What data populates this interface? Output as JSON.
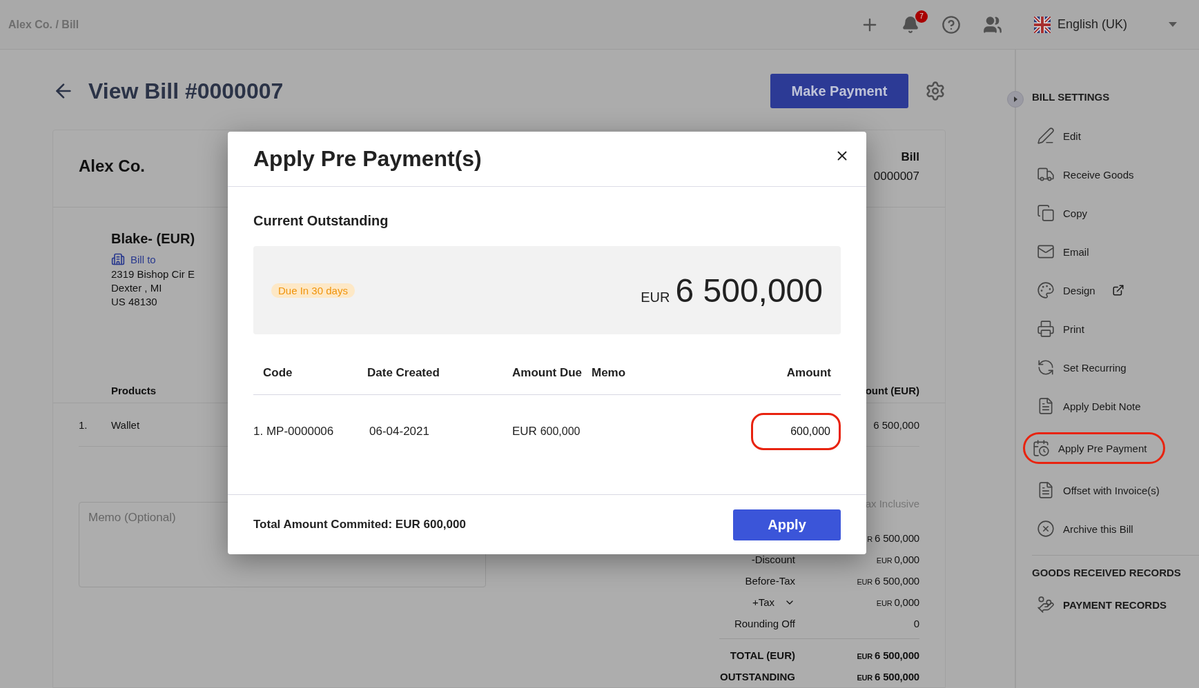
{
  "breadcrumb": "Alex Co. / Bill",
  "topbar": {
    "notification_count": "7",
    "language": "English (UK)"
  },
  "page": {
    "title": "View Bill #0000007",
    "primary_button": "Make Payment"
  },
  "bill": {
    "company": "Alex Co.",
    "doc_label": "Bill",
    "doc_number": "0000007",
    "vendor": "Blake- (EUR)",
    "bill_to_label": "Bill to",
    "address": [
      "2319 Bishop Cir E",
      "Dexter , MI",
      "US 48130"
    ],
    "products_header": "Products",
    "amount_header": "ount (EUR)",
    "lines": [
      {
        "index": "1.",
        "product": "Wallet",
        "amount": "6 500,000"
      }
    ],
    "memo_placeholder": "Memo (Optional)",
    "tax_mode": "ax Inclusive",
    "totals": [
      {
        "currency": "R",
        "value": "6 500,000",
        "bold": false
      },
      {
        "label": "-Discount",
        "currency": "EUR",
        "value": "0,000",
        "bold": false
      },
      {
        "label": "Before-Tax",
        "currency": "EUR",
        "value": "6 500,000",
        "bold": false
      },
      {
        "label": "+Tax",
        "currency": "EUR",
        "value": "0,000",
        "bold": false,
        "expandable": true
      },
      {
        "label": "Rounding Off",
        "value": "0",
        "bold": false
      },
      {
        "label": "TOTAL (EUR)",
        "currency": "EUR",
        "value": "6 500,000",
        "bold": true
      },
      {
        "label": "OUTSTANDING",
        "currency": "EUR",
        "value": "6 500,000",
        "bold": true
      }
    ]
  },
  "sidebar": {
    "title": "BILL SETTINGS",
    "items": [
      {
        "label": "Edit",
        "external": false,
        "highlighted": false
      },
      {
        "label": "Receive Goods",
        "external": false,
        "highlighted": false
      },
      {
        "label": "Copy",
        "external": false,
        "highlighted": false
      },
      {
        "label": "Email",
        "external": false,
        "highlighted": false
      },
      {
        "label": "Design",
        "external": true,
        "highlighted": false
      },
      {
        "label": "Print",
        "external": false,
        "highlighted": false
      },
      {
        "label": "Set Recurring",
        "external": false,
        "highlighted": false
      },
      {
        "label": "Apply Debit Note",
        "external": false,
        "highlighted": false
      },
      {
        "label": "Apply Pre Payment",
        "external": false,
        "highlighted": true
      },
      {
        "label": "Offset with Invoice(s)",
        "external": false,
        "highlighted": false
      },
      {
        "label": "Archive this Bill",
        "external": false,
        "highlighted": false
      }
    ],
    "section_title": "GOODS RECEIVED RECORDS",
    "records_link": "PAYMENT RECORDS"
  },
  "modal": {
    "title": "Apply Pre Payment(s)",
    "section_title": "Current Outstanding",
    "due_badge": "Due In 30 days",
    "currency": "EUR",
    "outstanding": "6 500,000",
    "columns": [
      "Code",
      "Date Created",
      "Amount Due",
      "Memo",
      "Amount"
    ],
    "rows": [
      {
        "code": "1. MP-0000006",
        "date": "06-04-2021",
        "due_currency": "EUR",
        "due_value": "600,000",
        "amount": "600,000",
        "highlighted": true
      }
    ],
    "total_text": "Total Amount Commited: EUR 600,000",
    "apply_button": "Apply"
  }
}
